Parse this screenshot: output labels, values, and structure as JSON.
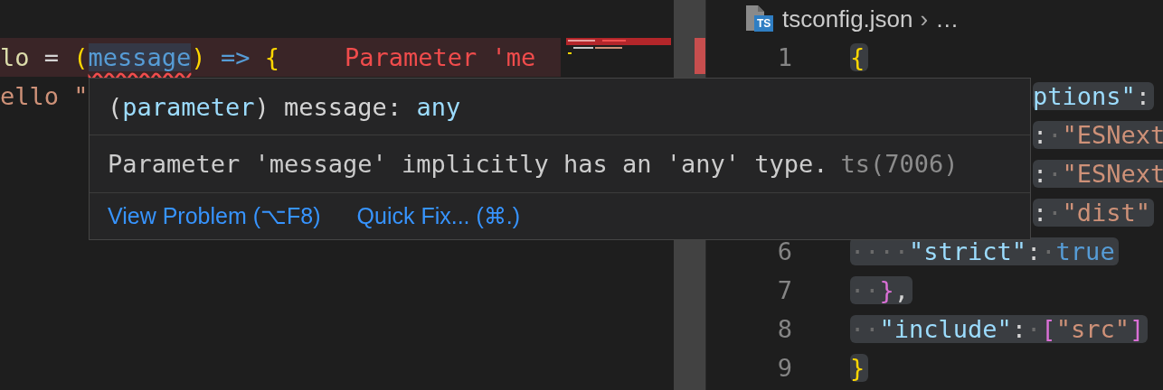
{
  "left_editor": {
    "lines": [
      {
        "error": true,
        "tokens": [
          {
            "text": "lo",
            "kind": "fn"
          },
          {
            "text": " = ",
            "kind": "op"
          },
          {
            "text": "(",
            "kind": "brace"
          },
          {
            "text": "message",
            "kind": "param-error"
          },
          {
            "text": ")",
            "kind": "brace"
          },
          {
            "text": " => ",
            "kind": "keyword"
          },
          {
            "text": "{",
            "kind": "brace"
          }
        ],
        "inline_error": "Parameter 'me"
      },
      {
        "error": false,
        "tokens": [
          {
            "text": "ello \"",
            "kind": "string"
          }
        ]
      }
    ]
  },
  "right_editor": {
    "breadcrumb": {
      "badge": "TS",
      "file": "tsconfig.json",
      "separator": "›",
      "more": "…"
    },
    "lines": [
      {
        "number": "1",
        "selected": true,
        "tokens": [
          {
            "text": "{",
            "kind": "brace"
          }
        ]
      },
      {
        "selected": true,
        "tokens": [
          {
            "text": "ptions\"",
            "kind": "key"
          },
          {
            "text": ":",
            "kind": "op"
          }
        ]
      },
      {
        "selected": true,
        "tokens": [
          {
            "text": ":",
            "kind": "op"
          },
          {
            "text": "·",
            "kind": "ws"
          },
          {
            "text": "\"ESNext",
            "kind": "string"
          }
        ]
      },
      {
        "selected": true,
        "tokens": [
          {
            "text": ":",
            "kind": "op"
          },
          {
            "text": "·",
            "kind": "ws"
          },
          {
            "text": "\"ESNext",
            "kind": "string"
          }
        ]
      },
      {
        "selected": true,
        "tokens": [
          {
            "text": ":",
            "kind": "op"
          },
          {
            "text": "·",
            "kind": "ws"
          },
          {
            "text": "\"dist\"",
            "kind": "string"
          }
        ]
      },
      {
        "number": "6",
        "selected": true,
        "tokens": [
          {
            "text": "····",
            "kind": "ws"
          },
          {
            "text": "\"strict\"",
            "kind": "key"
          },
          {
            "text": ":",
            "kind": "op"
          },
          {
            "text": "·",
            "kind": "ws"
          },
          {
            "text": "true",
            "kind": "keyword"
          }
        ]
      },
      {
        "number": "7",
        "selected": true,
        "tokens": [
          {
            "text": "··",
            "kind": "ws"
          },
          {
            "text": "}",
            "kind": "bracket"
          },
          {
            "text": ",",
            "kind": "op"
          }
        ]
      },
      {
        "number": "8",
        "selected": true,
        "tokens": [
          {
            "text": "··",
            "kind": "ws"
          },
          {
            "text": "\"include\"",
            "kind": "key"
          },
          {
            "text": ":",
            "kind": "op"
          },
          {
            "text": "·",
            "kind": "ws"
          },
          {
            "text": "[",
            "kind": "bracket"
          },
          {
            "text": "\"src\"",
            "kind": "string"
          },
          {
            "text": "]",
            "kind": "bracket"
          }
        ]
      },
      {
        "number": "9",
        "selected": true,
        "tokens": [
          {
            "text": "}",
            "kind": "brace"
          }
        ]
      }
    ]
  },
  "hover": {
    "signature": [
      {
        "text": "(",
        "kind": "op"
      },
      {
        "text": "parameter",
        "kind": "key"
      },
      {
        "text": ") message: ",
        "kind": "op"
      },
      {
        "text": "any",
        "kind": "key"
      }
    ],
    "message": "Parameter 'message' implicitly has an 'any' type.",
    "code": "ts(7006)",
    "actions": [
      "View Problem (⌥F8)",
      "Quick Fix... (⌘.)"
    ]
  }
}
